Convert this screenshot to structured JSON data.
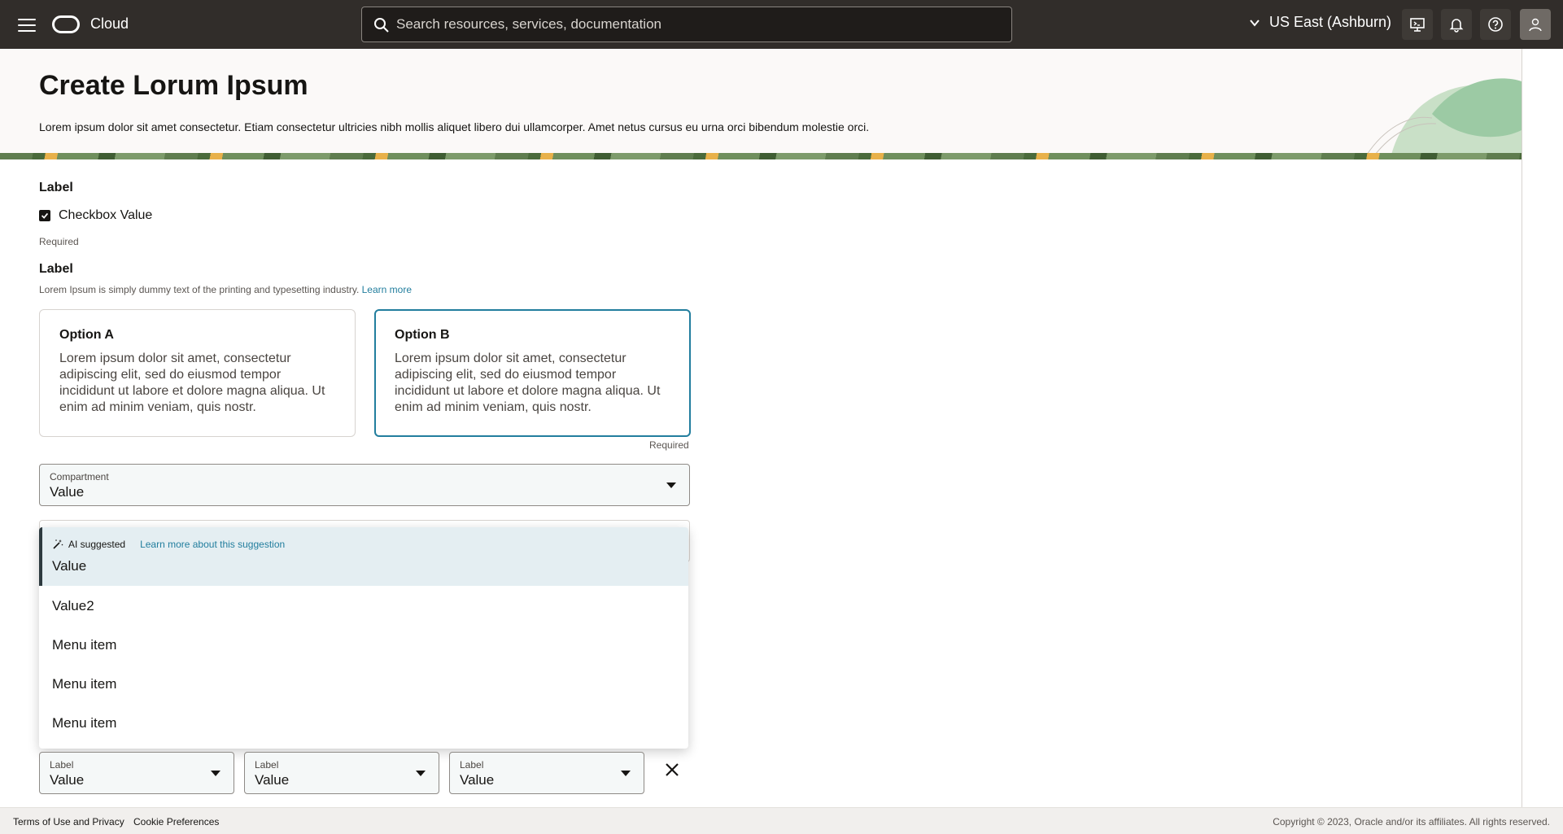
{
  "topbar": {
    "brand": "Cloud",
    "search_placeholder": "Search resources, services, documentation",
    "region": "US East (Ashburn)"
  },
  "header": {
    "title": "Create Lorum Ipsum",
    "description": "Lorem ipsum dolor sit amet consectetur. Etiam consectetur ultricies nibh mollis aliquet libero dui ullamcorper. Amet netus cursus eu urna orci bibendum molestie orci."
  },
  "form": {
    "checkbox_group": {
      "label": "Label",
      "checkbox_label": "Checkbox Value",
      "checked": true,
      "required": "Required"
    },
    "radio_group": {
      "label": "Label",
      "help_text": "Lorem Ipsum is simply dummy text of the printing and typesetting industry.",
      "help_link": "Learn more",
      "options": [
        {
          "title": "Option A",
          "body": "Lorem ipsum dolor sit amet, consectetur adipiscing elit, sed do eiusmod tempor incididunt ut labore et dolore magna aliqua. Ut enim ad minim veniam, quis nostr."
        },
        {
          "title": "Option B",
          "body": "Lorem ipsum dolor sit amet, consectetur adipiscing elit, sed do eiusmod tempor incididunt ut labore et dolore magna aliqua. Ut enim ad minim veniam, quis nostr."
        }
      ],
      "selected": "Option B",
      "required": "Required"
    },
    "compartment": {
      "label": "Compartment",
      "value": "Value"
    },
    "dropdown": {
      "ai_label": "AI suggested",
      "ai_link": "Learn more about this suggestion",
      "items": [
        "Value",
        "Value2",
        "Menu item",
        "Menu item",
        "Menu item"
      ]
    },
    "row_selects": [
      {
        "label": "Label",
        "value": "Value"
      },
      {
        "label": "Label",
        "value": "Value"
      },
      {
        "label": "Label",
        "value": "Value"
      }
    ]
  },
  "footer": {
    "terms": "Terms of Use and Privacy",
    "cookies": "Cookie Preferences",
    "copyright": "Copyright © 2023, Oracle and/or its affiliates. All rights reserved."
  },
  "colors": {
    "topbar": "#312d2a",
    "link": "#227e9e",
    "selected_border": "#227e9e",
    "suggested_bg": "#e4eef2"
  }
}
